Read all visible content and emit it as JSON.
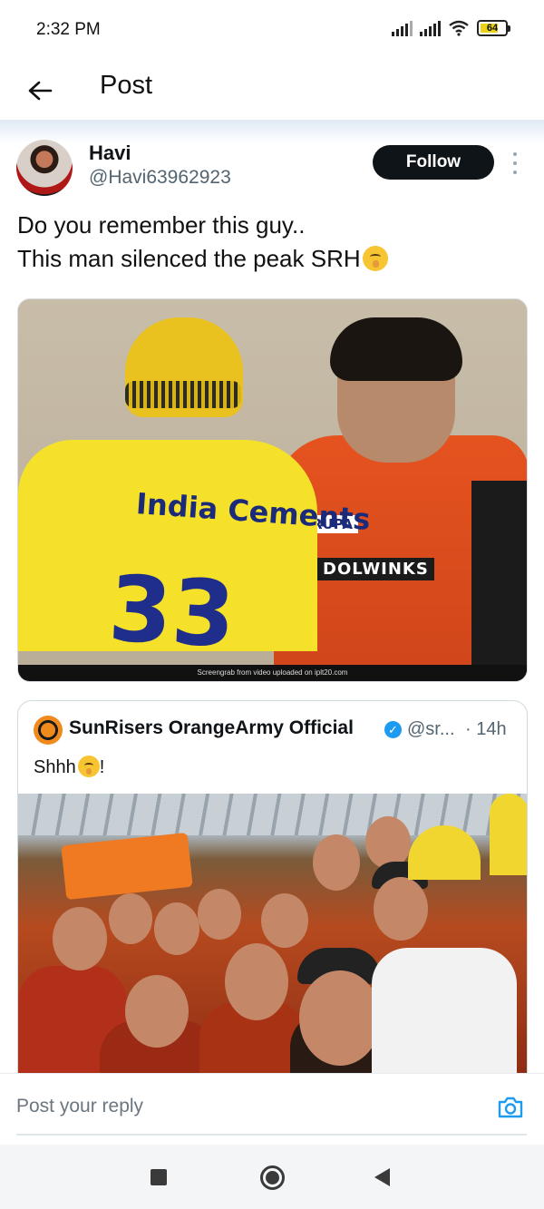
{
  "status_bar": {
    "time": "2:32 PM",
    "battery_level": "64",
    "icons": [
      "signal-icon",
      "signal-icon",
      "wifi-icon",
      "battery-icon"
    ]
  },
  "header": {
    "title": "Post",
    "back_icon": "arrow-left-icon"
  },
  "post": {
    "author_name": "Havi",
    "author_handle": "@Havi63962923",
    "follow_label": "Follow",
    "text_line_1": "Do you remember this guy..",
    "text_line_2": "This man silenced the peak SRH",
    "text_emoji": "shushing-face-emoji",
    "media": {
      "jersey_left_sponsor": "India Cements",
      "jersey_left_number": "33",
      "jersey_right_sponsor_1": "RUPA",
      "jersey_right_sponsor_2": "DOLWINKS",
      "caption": "Screengrab from video uploaded on iplt20.com"
    }
  },
  "quoted_post": {
    "author_name": "SunRisers OrangeArmy Official",
    "verified_icon": "verified-badge-icon",
    "handle": "@sr...",
    "time": "· 14h",
    "text": "Shhh",
    "text_suffix": "!",
    "text_emoji": "shushing-face-emoji"
  },
  "reply": {
    "placeholder": "Post your reply",
    "camera_icon": "camera-icon"
  },
  "nav_bar": {
    "icons": [
      "recents-square-icon",
      "home-circle-icon",
      "back-triangle-icon"
    ]
  }
}
